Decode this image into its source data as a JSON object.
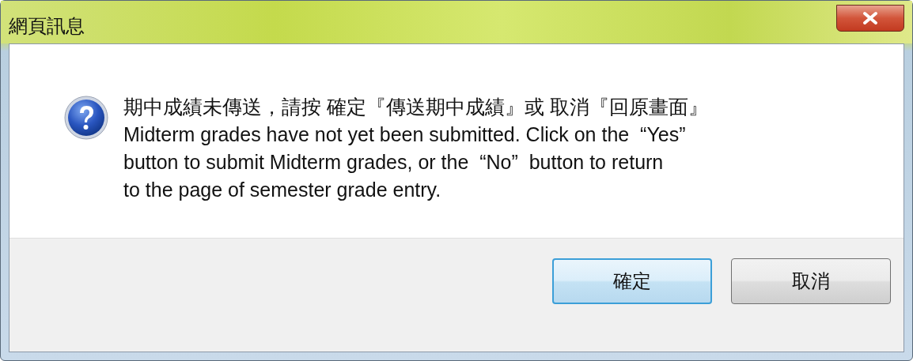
{
  "window": {
    "title": "網頁訊息"
  },
  "message": {
    "kind": "question",
    "text": "期中成績未傳送，請按 確定『傳送期中成績』或 取消『回原畫面』\nMidterm grades have not yet been submitted. Click on the  “Yes”\nbutton to submit Midterm grades, or the  “No”  button to return\nto the page of semester grade entry."
  },
  "buttons": [
    {
      "label": "確定",
      "default": true
    },
    {
      "label": "取消",
      "default": false
    }
  ]
}
